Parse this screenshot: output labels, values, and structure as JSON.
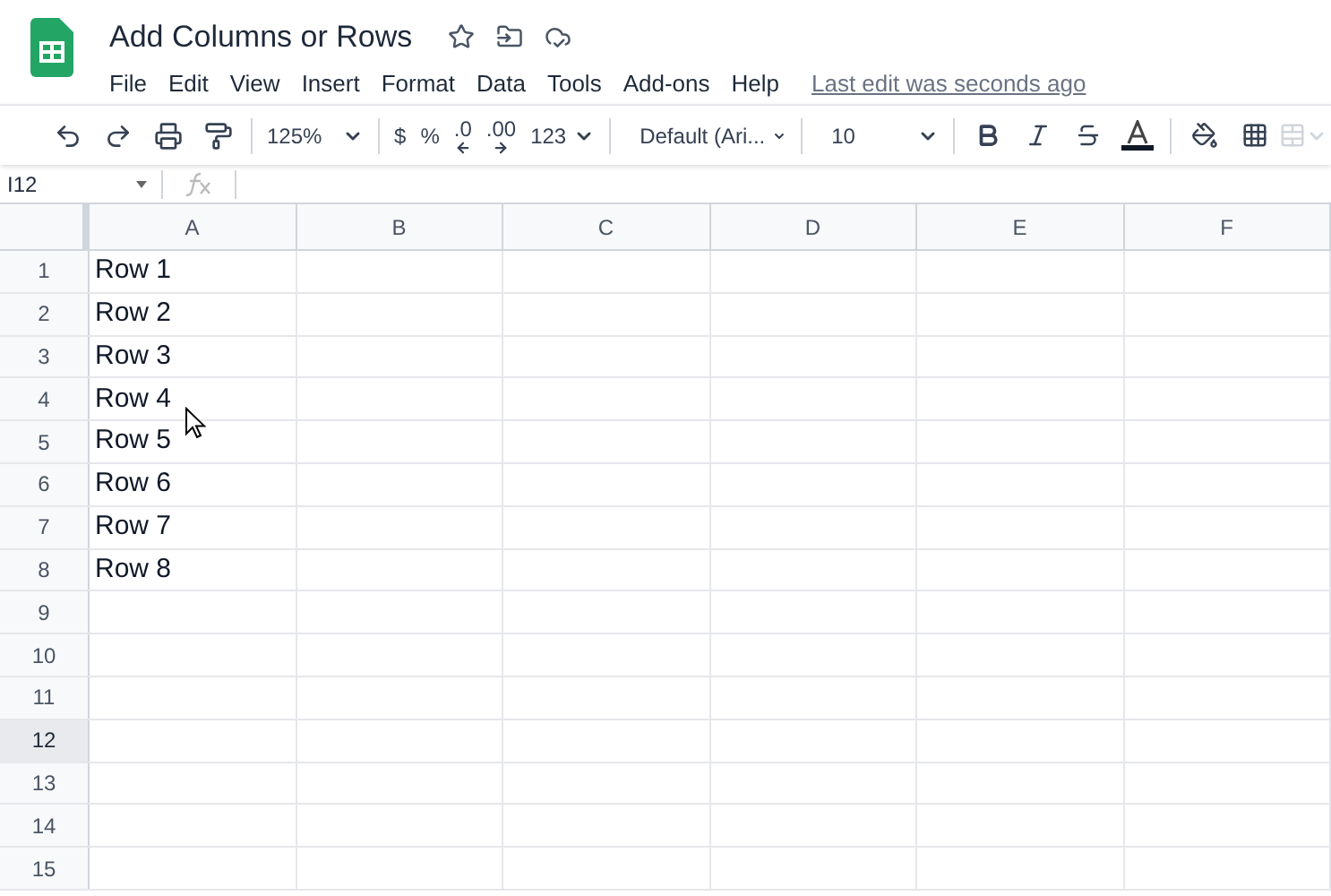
{
  "document": {
    "title": "Add Columns or Rows"
  },
  "menu": [
    "File",
    "Edit",
    "View",
    "Insert",
    "Format",
    "Data",
    "Tools",
    "Add-ons",
    "Help"
  ],
  "last_edit": "Last edit was seconds ago",
  "toolbar": {
    "zoom": "125%",
    "currency": "$",
    "percent": "%",
    "decrease_decimals": ".0",
    "increase_decimals": ".00",
    "number_format": "123",
    "font": "Default (Ari...",
    "font_size": "10"
  },
  "formula_bar": {
    "cell_ref": "I12"
  },
  "columns": [
    {
      "label": "A",
      "selected": false
    },
    {
      "label": "B",
      "selected": false
    },
    {
      "label": "C",
      "selected": false
    },
    {
      "label": "D",
      "selected": false
    },
    {
      "label": "E",
      "selected": false
    },
    {
      "label": "F",
      "selected": false
    }
  ],
  "rows": [
    {
      "number": "1",
      "selected": false,
      "cell_a": "Row 1"
    },
    {
      "number": "2",
      "selected": false,
      "cell_a": "Row 2"
    },
    {
      "number": "3",
      "selected": false,
      "cell_a": "Row 3"
    },
    {
      "number": "4",
      "selected": false,
      "cell_a": "Row 4"
    },
    {
      "number": "5",
      "selected": false,
      "cell_a": "Row 5"
    },
    {
      "number": "6",
      "selected": false,
      "cell_a": "Row 6"
    },
    {
      "number": "7",
      "selected": false,
      "cell_a": "Row 7"
    },
    {
      "number": "8",
      "selected": false,
      "cell_a": "Row 8"
    },
    {
      "number": "9",
      "selected": false
    },
    {
      "number": "10",
      "selected": false
    },
    {
      "number": "11",
      "selected": false
    },
    {
      "number": "12",
      "selected": true
    },
    {
      "number": "13",
      "selected": false
    },
    {
      "number": "14",
      "selected": false
    },
    {
      "number": "15",
      "selected": false
    }
  ]
}
